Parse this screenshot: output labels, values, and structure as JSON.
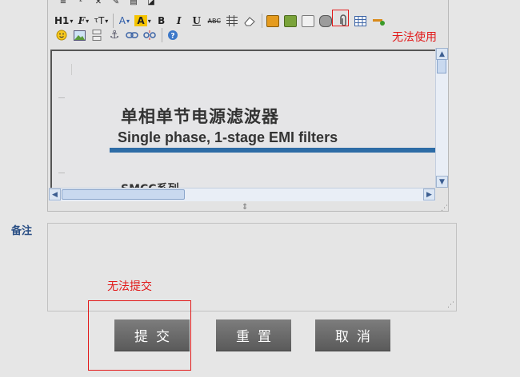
{
  "toolbar": {
    "row1": {
      "heading": "H1",
      "font_family": "F",
      "font_size": "T",
      "font_color": "A",
      "highlight": "A",
      "bold": "B",
      "italic": "I",
      "underline": "U",
      "strike": "ABC"
    },
    "icons_row1": [
      "image-icon",
      "insert-image-icon",
      "flash-icon",
      "media-icon",
      "attachment-icon",
      "table-icon",
      "horizontal-line-icon"
    ],
    "icons_row2": [
      "emoticon-icon",
      "image-icon",
      "page-break-icon",
      "anchor-icon",
      "link-icon",
      "unlink-icon",
      "help-icon"
    ],
    "annotation": "无法使用"
  },
  "document": {
    "title_cn": "单相单节电源滤波器",
    "title_en": "Single phase, 1-stage EMI filters",
    "series": "SMCC系列"
  },
  "remarks": {
    "label": "备注",
    "value": ""
  },
  "actions": {
    "annotation": "无法提交",
    "submit_label": "提交",
    "reset_label": "重置",
    "cancel_label": "取消"
  },
  "colors": {
    "annotation_red": "#e21b1b",
    "rule_blue": "#2d6ca6",
    "label_blue": "#2a4f85",
    "button_gray": "#6b6b6b"
  }
}
